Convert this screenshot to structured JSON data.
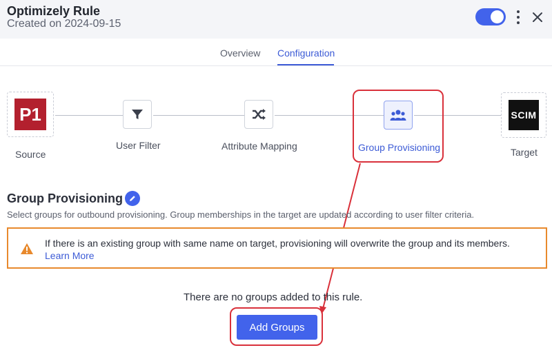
{
  "header": {
    "title": "Optimizely Rule",
    "subtitle": "Created on 2024-09-15",
    "toggle_on": true,
    "menu_icon": "kebab-menu-icon",
    "close_icon": "close-icon"
  },
  "tabs": [
    {
      "label": "Overview",
      "active": false
    },
    {
      "label": "Configuration",
      "active": true
    }
  ],
  "flow": {
    "stages": [
      {
        "label": "Source",
        "icon": "p1-logo"
      },
      {
        "label": "User Filter",
        "icon": "filter-icon"
      },
      {
        "label": "Attribute Mapping",
        "icon": "shuffle-icon"
      },
      {
        "label": "Group Provisioning",
        "icon": "users-group-icon",
        "active": true
      },
      {
        "label": "Target",
        "icon": "scim-logo"
      }
    ],
    "source_logo_text": "P1",
    "target_logo_text": "SCIM"
  },
  "section": {
    "title": "Group Provisioning",
    "description": "Select groups for outbound provisioning. Group memberships in the target are updated according to user filter criteria."
  },
  "alert": {
    "message": "If there is an existing group with same name on target, provisioning will overwrite the group and its members.",
    "link": "Learn More"
  },
  "empty_state": {
    "message": "There are no groups added to this rule.",
    "button": "Add Groups"
  },
  "colors": {
    "accent": "#4263eb",
    "active_text": "#3c5bd6",
    "warning": "#e8892c",
    "annotation": "#d9303a",
    "source_brand": "#b3202e"
  }
}
